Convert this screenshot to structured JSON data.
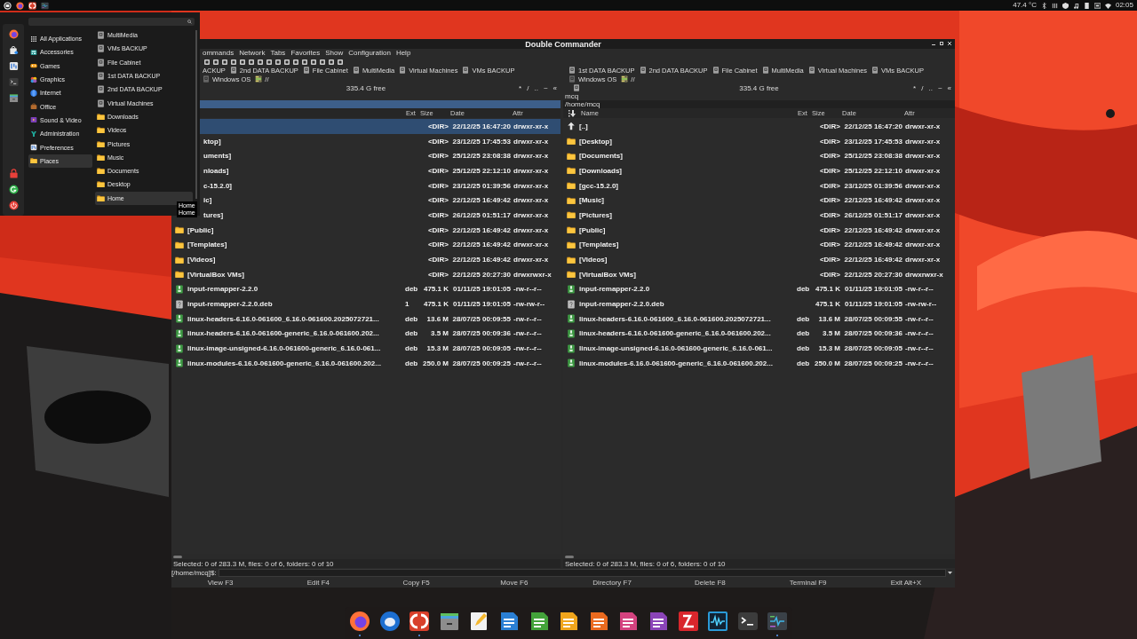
{
  "top_panel": {
    "launchers": [
      {
        "kind": "menu"
      },
      {
        "kind": "browser"
      },
      {
        "kind": "dc"
      },
      {
        "kind": "monitor"
      }
    ],
    "temperature": "47.4 °C",
    "clock": "02:05"
  },
  "app_menu": {
    "favorites": [
      {
        "kind": "browser"
      },
      {
        "kind": "store"
      },
      {
        "kind": "settings"
      },
      {
        "kind": "terminal"
      },
      {
        "kind": "files"
      }
    ],
    "session": [
      {
        "kind": "lock"
      },
      {
        "kind": "logout"
      },
      {
        "kind": "power"
      }
    ],
    "categories": [
      {
        "label": "All Applications",
        "selected": false
      },
      {
        "label": "Accessories",
        "selected": false
      },
      {
        "label": "Games",
        "selected": false
      },
      {
        "label": "Graphics",
        "selected": false
      },
      {
        "label": "Internet",
        "selected": false
      },
      {
        "label": "Office",
        "selected": false
      },
      {
        "label": "Sound & Video",
        "selected": false
      },
      {
        "label": "Administration",
        "selected": false
      },
      {
        "label": "Preferences",
        "selected": false
      },
      {
        "label": "Places",
        "selected": true
      }
    ],
    "places": [
      {
        "label": "MultiMedia",
        "kind": "drive",
        "selected": false
      },
      {
        "label": "VMs BACKUP",
        "kind": "drive",
        "selected": false
      },
      {
        "label": "File Cabinet",
        "kind": "drive",
        "selected": false
      },
      {
        "label": "1st DATA BACKUP",
        "kind": "drive",
        "selected": false
      },
      {
        "label": "2nd DATA BACKUP",
        "kind": "drive",
        "selected": false
      },
      {
        "label": "Virtual Machines",
        "kind": "drive",
        "selected": false
      },
      {
        "label": "Downloads",
        "kind": "folder",
        "selected": false
      },
      {
        "label": "Videos",
        "kind": "folder",
        "selected": false
      },
      {
        "label": "Pictures",
        "kind": "folder",
        "selected": false
      },
      {
        "label": "Music",
        "kind": "folder",
        "selected": false
      },
      {
        "label": "Documents",
        "kind": "folder",
        "selected": false
      },
      {
        "label": "Desktop",
        "kind": "folder",
        "selected": false
      },
      {
        "label": "Home",
        "kind": "folder",
        "selected": true
      }
    ]
  },
  "tooltip": [
    "Home",
    "Home"
  ],
  "window": {
    "title": "Double Commander",
    "menu": [
      "ommands",
      "Network",
      "Tabs",
      "Favorites",
      "Show",
      "Configuration",
      "Help"
    ],
    "panels": [
      {
        "active": true,
        "drives": [
          {
            "kind": "cut",
            "label": "ACKUP"
          },
          {
            "kind": "drive",
            "label": "2nd DATA BACKUP"
          },
          {
            "kind": "drive",
            "label": "File Cabinet"
          },
          {
            "kind": "drive",
            "label": "MultiMedia"
          },
          {
            "kind": "drive",
            "label": "Virtual Machines"
          },
          {
            "kind": "drive",
            "label": "VMs BACKUP"
          },
          {
            "kind": "drive-off",
            "label": "Windows OS"
          },
          {
            "kind": "root",
            "label": "//"
          }
        ],
        "drive_button": false,
        "free": "335.4 G free",
        "nav_buttons": [
          "*",
          "/",
          "..",
          "~",
          "«"
        ],
        "columns": [
          {
            "kind": "ext",
            "label": "Ext"
          },
          {
            "kind": "size",
            "label": "Size"
          },
          {
            "kind": "date",
            "label": "Date"
          },
          {
            "kind": "attr",
            "label": "Attr"
          }
        ],
        "rows": [
          {
            "kind": "hidden",
            "size": "<DIR>",
            "date": "22/12/25 16:47:20",
            "attr": "drwxr-xr-x",
            "selected": true
          },
          {
            "kind": "hidden",
            "name": "ktop]",
            "size": "<DIR>",
            "date": "23/12/25 17:45:53",
            "attr": "drwxr-xr-x",
            "selected": false
          },
          {
            "kind": "hidden",
            "name": "uments]",
            "size": "<DIR>",
            "date": "25/12/25 23:08:38",
            "attr": "drwxr-xr-x",
            "selected": false
          },
          {
            "kind": "hidden",
            "name": "nloads]",
            "size": "<DIR>",
            "date": "25/12/25 22:12:10",
            "attr": "drwxr-xr-x",
            "selected": false
          },
          {
            "kind": "hidden",
            "name": "c-15.2.0]",
            "size": "<DIR>",
            "date": "23/12/25 01:39:56",
            "attr": "drwxr-xr-x",
            "selected": false
          },
          {
            "kind": "hidden",
            "name": "ic]",
            "size": "<DIR>",
            "date": "22/12/25 16:49:42",
            "attr": "drwxr-xr-x",
            "selected": false
          },
          {
            "kind": "hidden",
            "name": "tures]",
            "size": "<DIR>",
            "date": "26/12/25 01:51:17",
            "attr": "drwxr-xr-x",
            "selected": false
          },
          {
            "kind": "folder",
            "name": "[Public]",
            "size": "<DIR>",
            "date": "22/12/25 16:49:42",
            "attr": "drwxr-xr-x",
            "selected": false
          },
          {
            "kind": "folder",
            "name": "[Templates]",
            "size": "<DIR>",
            "date": "22/12/25 16:49:42",
            "attr": "drwxr-xr-x",
            "selected": false
          },
          {
            "kind": "folder",
            "name": "[Videos]",
            "size": "<DIR>",
            "date": "22/12/25 16:49:42",
            "attr": "drwxr-xr-x",
            "selected": false
          },
          {
            "kind": "folder",
            "name": "[VirtualBox VMs]",
            "size": "<DIR>",
            "date": "22/12/25 20:27:30",
            "attr": "drwxrwxr-x",
            "selected": false
          },
          {
            "kind": "deb",
            "name": "input-remapper-2.2.0",
            "ext": "deb",
            "size": "475.1 K",
            "date": "01/11/25 19:01:05",
            "attr": "-rw-r--r--",
            "selected": false
          },
          {
            "kind": "unknown",
            "name": "input-remapper-2.2.0.deb",
            "ext": "1",
            "size": "475.1 K",
            "date": "01/11/25 19:01:05",
            "attr": "-rw-rw-r--",
            "selected": false
          },
          {
            "kind": "deb",
            "name": "linux-headers-6.16.0-061600_6.16.0-061600.2025072721...",
            "ext": "deb",
            "size": "13.6 M",
            "date": "28/07/25 00:09:55",
            "attr": "-rw-r--r--",
            "selected": false
          },
          {
            "kind": "deb",
            "name": "linux-headers-6.16.0-061600-generic_6.16.0-061600.202...",
            "ext": "deb",
            "size": "3.5 M",
            "date": "28/07/25 00:09:36",
            "attr": "-rw-r--r--",
            "selected": false
          },
          {
            "kind": "deb",
            "name": "linux-image-unsigned-6.16.0-061600-generic_6.16.0-061...",
            "ext": "deb",
            "size": "15.3 M",
            "date": "28/07/25 00:09:05",
            "attr": "-rw-r--r--",
            "selected": false
          },
          {
            "kind": "deb",
            "name": "linux-modules-6.16.0-061600-generic_6.16.0-061600.202...",
            "ext": "deb",
            "size": "250.0 M",
            "date": "28/07/25 00:09:25",
            "attr": "-rw-r--r--",
            "selected": false
          }
        ],
        "status": "Selected: 0 of 283.3 M, files: 0 of 6, folders: 0 of 10"
      },
      {
        "active": false,
        "drives": [
          {
            "kind": "drive",
            "label": "1st DATA BACKUP"
          },
          {
            "kind": "drive",
            "label": "2nd DATA BACKUP"
          },
          {
            "kind": "drive",
            "label": "File Cabinet"
          },
          {
            "kind": "drive",
            "label": "MultiMedia"
          },
          {
            "kind": "drive",
            "label": "Virtual Machines"
          },
          {
            "kind": "drive",
            "label": "VMs BACKUP"
          },
          {
            "kind": "drive-off",
            "label": "Windows OS"
          },
          {
            "kind": "root",
            "label": "//"
          }
        ],
        "drive_button": true,
        "free": "335.4 G free",
        "nav_buttons": [
          "*",
          "/",
          "..",
          "~",
          "«"
        ],
        "tab": "mcq",
        "path": "/home/mcq",
        "columns": [
          {
            "kind": "sort"
          },
          {
            "kind": "name",
            "label": "Name"
          },
          {
            "kind": "ext",
            "label": "Ext"
          },
          {
            "kind": "size",
            "label": "Size"
          },
          {
            "kind": "date",
            "label": "Date"
          },
          {
            "kind": "attr",
            "label": "Attr"
          }
        ],
        "rows": [
          {
            "kind": "up",
            "name": "[..]",
            "size": "<DIR>",
            "date": "22/12/25 16:47:20",
            "attr": "drwxr-xr-x",
            "selected": false
          },
          {
            "kind": "folder",
            "name": "[Desktop]",
            "size": "<DIR>",
            "date": "23/12/25 17:45:53",
            "attr": "drwxr-xr-x",
            "selected": false
          },
          {
            "kind": "folder",
            "name": "[Documents]",
            "size": "<DIR>",
            "date": "25/12/25 23:08:38",
            "attr": "drwxr-xr-x",
            "selected": false
          },
          {
            "kind": "folder",
            "name": "[Downloads]",
            "size": "<DIR>",
            "date": "25/12/25 22:12:10",
            "attr": "drwxr-xr-x",
            "selected": false
          },
          {
            "kind": "folder",
            "name": "[gcc-15.2.0]",
            "size": "<DIR>",
            "date": "23/12/25 01:39:56",
            "attr": "drwxr-xr-x",
            "selected": false
          },
          {
            "kind": "folder",
            "name": "[Music]",
            "size": "<DIR>",
            "date": "22/12/25 16:49:42",
            "attr": "drwxr-xr-x",
            "selected": false
          },
          {
            "kind": "folder",
            "name": "[Pictures]",
            "size": "<DIR>",
            "date": "26/12/25 01:51:17",
            "attr": "drwxr-xr-x",
            "selected": false
          },
          {
            "kind": "folder",
            "name": "[Public]",
            "size": "<DIR>",
            "date": "22/12/25 16:49:42",
            "attr": "drwxr-xr-x",
            "selected": false
          },
          {
            "kind": "folder",
            "name": "[Templates]",
            "size": "<DIR>",
            "date": "22/12/25 16:49:42",
            "attr": "drwxr-xr-x",
            "selected": false
          },
          {
            "kind": "folder",
            "name": "[Videos]",
            "size": "<DIR>",
            "date": "22/12/25 16:49:42",
            "attr": "drwxr-xr-x",
            "selected": false
          },
          {
            "kind": "folder",
            "name": "[VirtualBox VMs]",
            "size": "<DIR>",
            "date": "22/12/25 20:27:30",
            "attr": "drwxrwxr-x",
            "selected": false
          },
          {
            "kind": "deb",
            "name": "input-remapper-2.2.0",
            "ext": "deb",
            "size": "475.1 K",
            "date": "01/11/25 19:01:05",
            "attr": "-rw-r--r--",
            "selected": false
          },
          {
            "kind": "unknown",
            "name": "input-remapper-2.2.0.deb",
            "size": "475.1 K",
            "date": "01/11/25 19:01:05",
            "attr": "-rw-rw-r--",
            "selected": false
          },
          {
            "kind": "deb",
            "name": "linux-headers-6.16.0-061600_6.16.0-061600.2025072721...",
            "ext": "deb",
            "size": "13.6 M",
            "date": "28/07/25 00:09:55",
            "attr": "-rw-r--r--",
            "selected": false
          },
          {
            "kind": "deb",
            "name": "linux-headers-6.16.0-061600-generic_6.16.0-061600.202...",
            "ext": "deb",
            "size": "3.5 M",
            "date": "28/07/25 00:09:36",
            "attr": "-rw-r--r--",
            "selected": false
          },
          {
            "kind": "deb",
            "name": "linux-image-unsigned-6.16.0-061600-generic_6.16.0-061...",
            "ext": "deb",
            "size": "15.3 M",
            "date": "28/07/25 00:09:05",
            "attr": "-rw-r--r--",
            "selected": false
          },
          {
            "kind": "deb",
            "name": "linux-modules-6.16.0-061600-generic_6.16.0-061600.202...",
            "ext": "deb",
            "size": "250.0 M",
            "date": "28/07/25 00:09:25",
            "attr": "-rw-r--r--",
            "selected": false
          }
        ],
        "status": "Selected: 0 of 283.3 M, files: 0 of 6, folders: 0 of 10"
      }
    ],
    "command_prompt": "[/home/mcq]$:",
    "function_keys": [
      "View F3",
      "Edit F4",
      "Copy F5",
      "Move F6",
      "Directory F7",
      "Delete F8",
      "Terminal F9",
      "Exit Alt+X"
    ]
  },
  "dock": [
    {
      "kind": "browser",
      "running": true
    },
    {
      "kind": "mail",
      "running": false
    },
    {
      "kind": "dc",
      "running": true
    },
    {
      "kind": "files",
      "running": false
    },
    {
      "kind": "editor",
      "running": false
    },
    {
      "kind": "writer",
      "running": false
    },
    {
      "kind": "calc",
      "running": false
    },
    {
      "kind": "impress",
      "running": false
    },
    {
      "kind": "draw",
      "running": false
    },
    {
      "kind": "math",
      "running": false
    },
    {
      "kind": "base",
      "running": false
    },
    {
      "kind": "ftp",
      "running": false
    },
    {
      "kind": "wave",
      "running": false
    },
    {
      "kind": "terminal",
      "running": false
    },
    {
      "kind": "monitor",
      "running": true
    }
  ]
}
